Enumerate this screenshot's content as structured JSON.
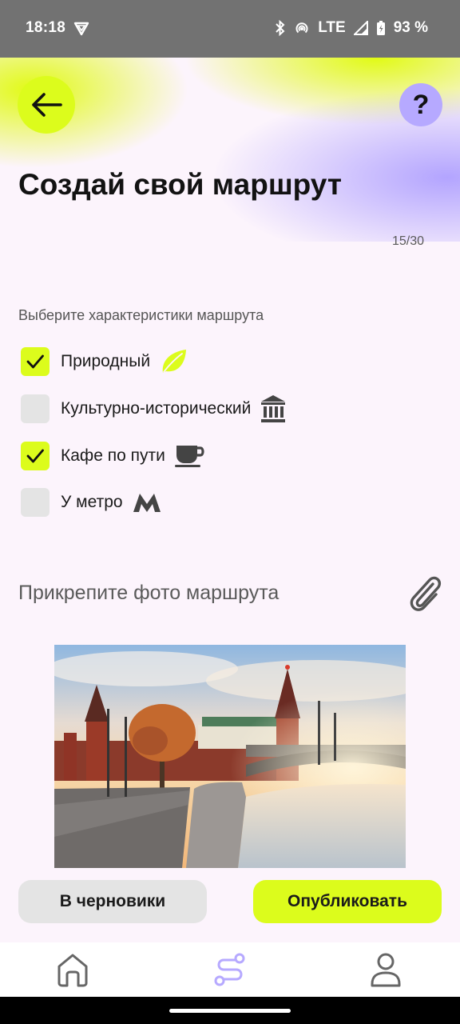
{
  "status_bar": {
    "time": "18:18",
    "network": "LTE",
    "battery": "93 %",
    "icons": [
      "shield-icon",
      "bluetooth-icon",
      "hotspot-icon",
      "signal-icon",
      "battery-icon"
    ]
  },
  "header": {
    "back_icon": "arrow-left-icon",
    "help_label": "?",
    "title": "Создай свой маршрут",
    "counter": "15/30"
  },
  "characteristics": {
    "label": "Выберите характеристики маршрута",
    "options": [
      {
        "label": "Природный",
        "checked": true,
        "icon": "leaf-icon",
        "icon_color": "#dcfc1c"
      },
      {
        "label": "Культурно-исторический",
        "checked": false,
        "icon": "museum-icon"
      },
      {
        "label": "Кафе по пути",
        "checked": true,
        "icon": "coffee-cup-icon"
      },
      {
        "label": "У метро",
        "checked": false,
        "icon": "metro-icon"
      }
    ]
  },
  "attach": {
    "label": "Прикрепите фото маршрута",
    "icon": "paperclip-icon"
  },
  "actions": {
    "draft_label": "В черновики",
    "publish_label": "Опубликовать"
  },
  "bottom_nav": {
    "items": [
      "home-icon",
      "route-icon",
      "profile-icon"
    ],
    "active": "route-icon"
  },
  "colors": {
    "accent": "#dcfc1c",
    "violet": "#b6a9ff",
    "background": "#fcf4fc",
    "muted_button": "#e4e4e4"
  }
}
